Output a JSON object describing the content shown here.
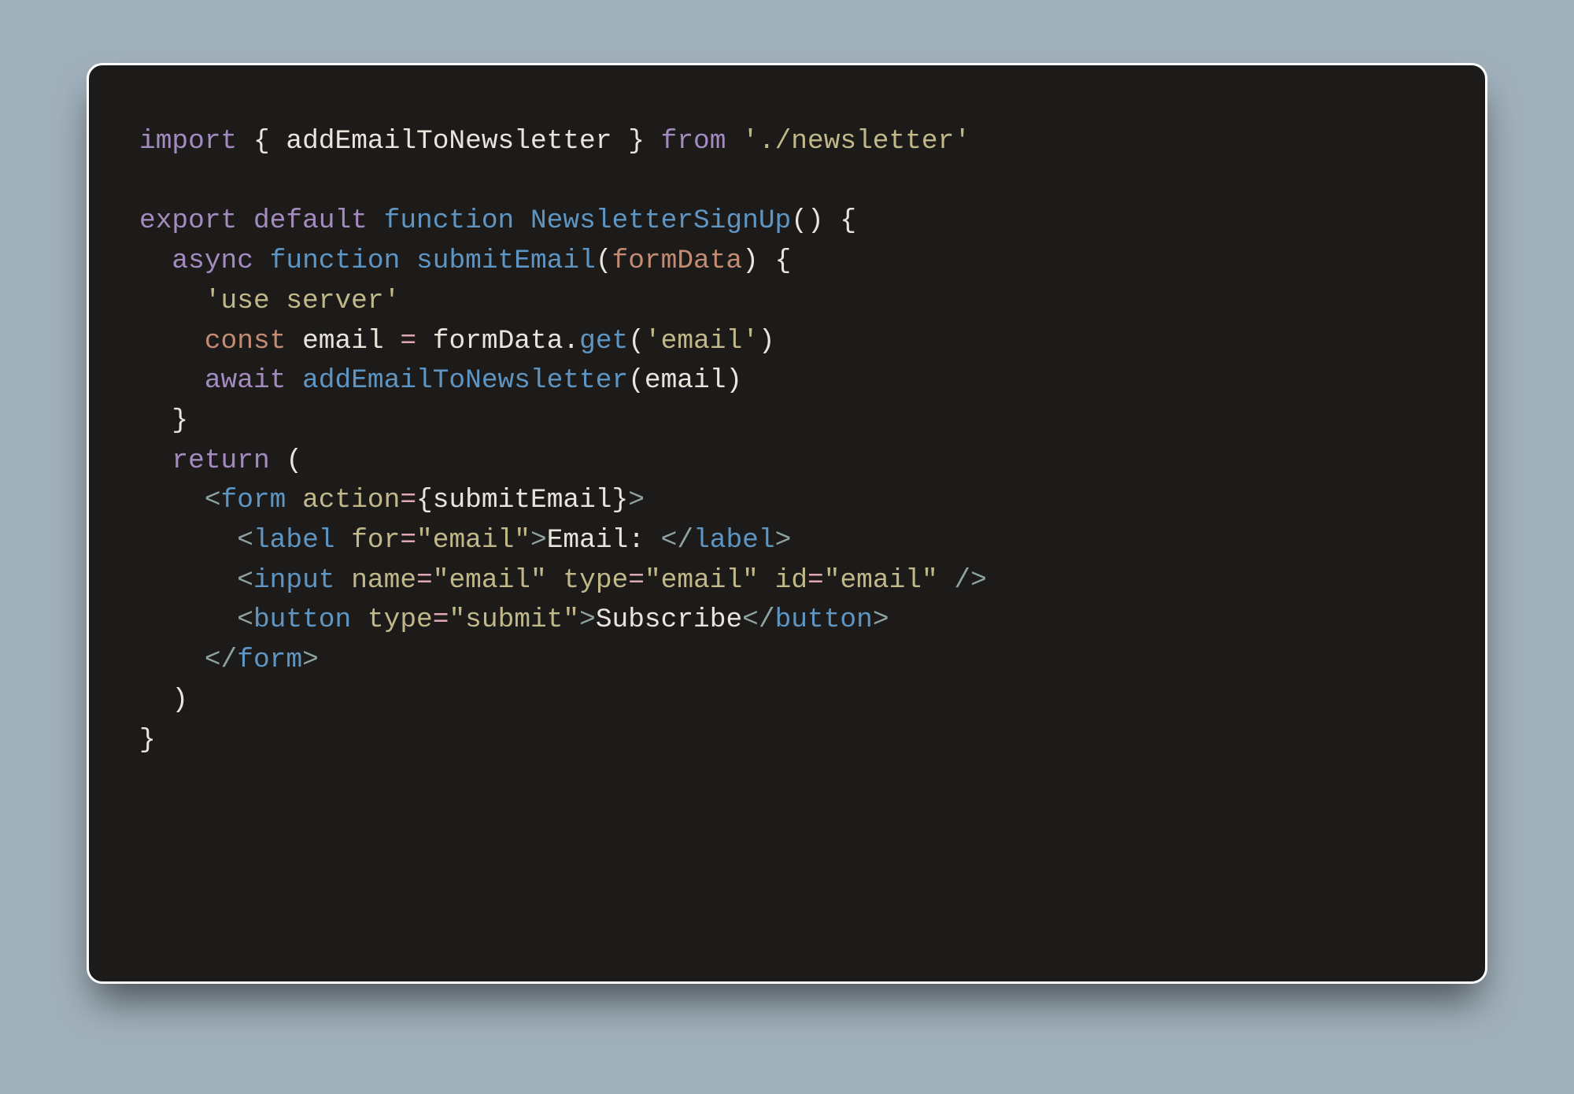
{
  "code": {
    "l1": {
      "import": "import",
      "braceOpen": "{",
      "imported": "addEmailToNewsletter",
      "braceClose": "}",
      "from": "from",
      "path": "'./newsletter'"
    },
    "l3": {
      "export": "export",
      "default": "default",
      "function": "function",
      "name": "NewsletterSignUp",
      "parens": "()",
      "brace": "{"
    },
    "l4": {
      "async": "async",
      "function": "function",
      "name": "submitEmail",
      "paramOpen": "(",
      "param": "formData",
      "paramClose": ")",
      "brace": "{"
    },
    "l5": {
      "directive": "'use server'"
    },
    "l6": {
      "const": "const",
      "varName": "email",
      "eq": "=",
      "obj": "formData",
      "dot": ".",
      "method": "get",
      "argOpen": "(",
      "arg": "'email'",
      "argClose": ")"
    },
    "l7": {
      "await": "await",
      "fn": "addEmailToNewsletter",
      "argOpen": "(",
      "arg": "email",
      "argClose": ")"
    },
    "l8": {
      "brace": "}"
    },
    "l9": {
      "return": "return",
      "paren": "("
    },
    "l10": {
      "lt": "<",
      "tag": "form",
      "attr": "action",
      "eq": "=",
      "exprOpen": "{",
      "expr": "submitEmail",
      "exprClose": "}",
      "gt": ">"
    },
    "l11": {
      "lt": "<",
      "tag": "label",
      "attr": "for",
      "eq": "=",
      "val": "\"email\"",
      "gt": ">",
      "text": "Email: ",
      "ltc": "</",
      "tagc": "label",
      "gtc": ">"
    },
    "l12": {
      "lt": "<",
      "tag": "input",
      "attr1": "name",
      "eq1": "=",
      "val1": "\"email\"",
      "attr2": "type",
      "eq2": "=",
      "val2": "\"email\"",
      "attr3": "id",
      "eq3": "=",
      "val3": "\"email\"",
      "close": "/>"
    },
    "l13": {
      "lt": "<",
      "tag": "button",
      "attr": "type",
      "eq": "=",
      "val": "\"submit\"",
      "gt": ">",
      "text": "Subscribe",
      "ltc": "</",
      "tagc": "button",
      "gtc": ">"
    },
    "l14": {
      "ltc": "</",
      "tag": "form",
      "gtc": ">"
    },
    "l15": {
      "paren": ")"
    },
    "l16": {
      "brace": "}"
    }
  }
}
